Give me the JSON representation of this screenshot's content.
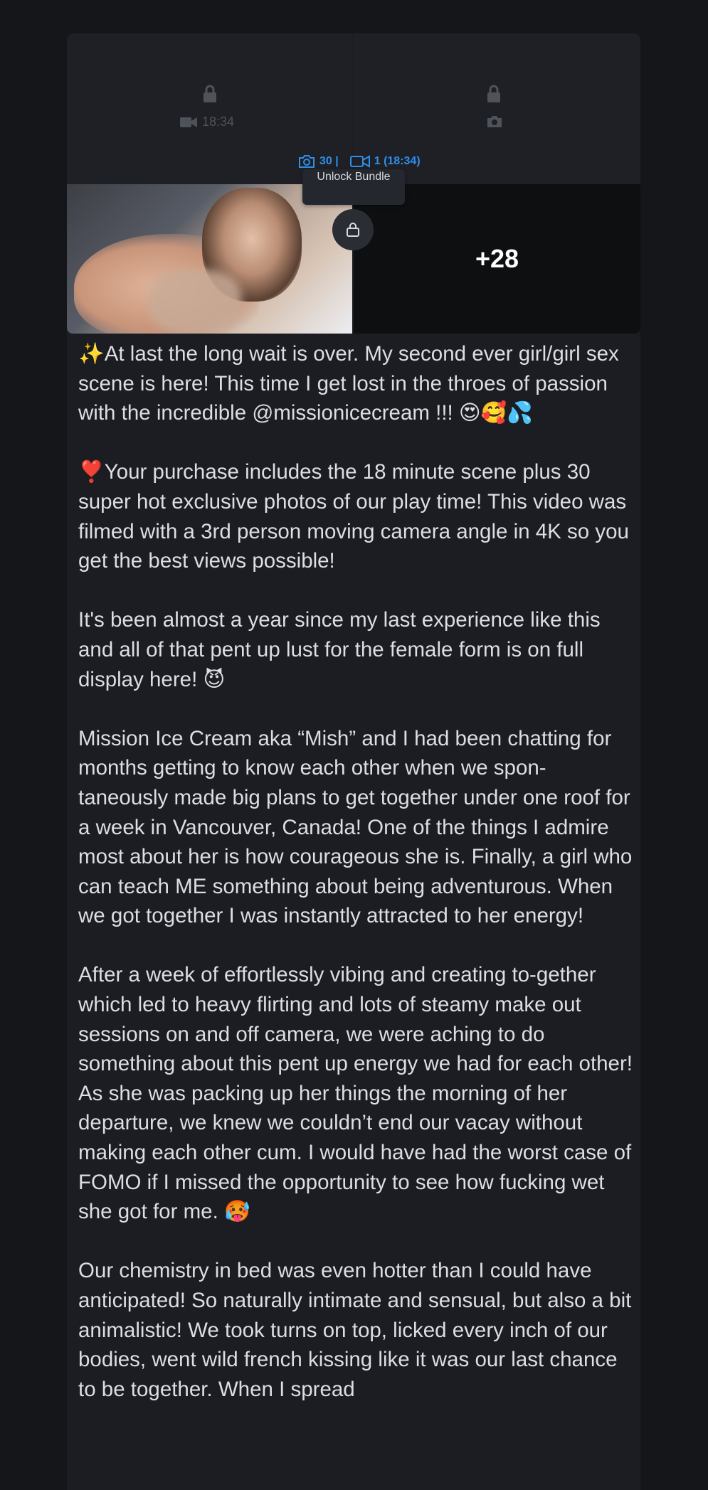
{
  "post": {
    "menu_icon": "more-dots-icon",
    "locked_preview": {
      "left_video_duration": "18:34",
      "icons": [
        "lock-icon",
        "video-camera-icon",
        "photo-camera-icon"
      ]
    },
    "bundle": {
      "photo_count": "30 |",
      "video_count": "1 (18:34)",
      "tooltip": "Unlock Bundle"
    },
    "more_media_label": "+28",
    "paragraphs": [
      "✨At last the long wait is over. My second ever girl/girl sex scene is here! This time I get lost in the throes of passion with the incredible @missionicecream !!! 😍🥰💦",
      "❣️Your purchase includes the 18 minute scene plus 30 super hot exclusive photos of our play time! This video was filmed with a 3rd person moving camera angle in 4K so you get the best views possible!",
      "It's been almost a year since my last experience like this and all of that pent up lust for the female form is on full display here! 😈",
      "Mission Ice Cream aka “Mish” and I had been chatting for months getting to know each other when we spon-taneously made big plans to get together under one roof for a week in Vancouver, Canada! One of the things I admire most about her is how courageous she is. Finally, a girl who can teach ME something about being adventurous. When we got together I was instantly attracted to her energy!",
      "After a week of effortlessly vibing and creating to-gether which led to heavy flirting and lots of steamy make out sessions on and off camera, we were aching to do something about this pent up energy we had for each other! As she was packing up her things the morning of her departure, we knew we couldn’t end our vacay without making each other cum. I would have had the worst case of FOMO if I missed the opportunity to see how fucking wet she got for me. 🥵",
      "Our chemistry in bed was even hotter than I could have anticipated! So naturally intimate and sensual, but also a bit animalistic! We took turns on top, licked every inch of our bodies, went wild french kissing like it was our last chance to be together. When I spread"
    ]
  },
  "colors": {
    "page_bg": "#141619",
    "card_bg": "#1b1d22",
    "accent": "#2f8fe8",
    "text": "#dcdee1"
  }
}
